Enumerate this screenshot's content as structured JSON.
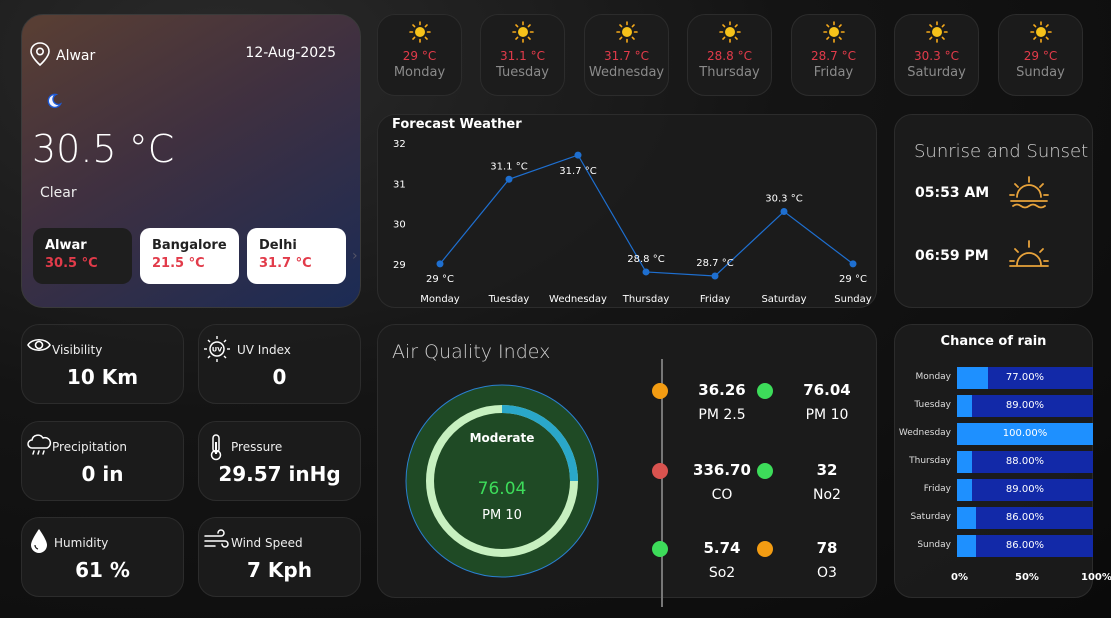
{
  "location": {
    "city": "Alwar",
    "date": "12-Aug-2025",
    "icon": "moon-icon",
    "temperature": "30.5 °C",
    "condition": "Clear"
  },
  "cities": [
    {
      "name": "Alwar",
      "temp": "30.5 °C"
    },
    {
      "name": "Bangalore",
      "temp": "21.5 °C"
    },
    {
      "name": "Delhi",
      "temp": "31.7 °C"
    }
  ],
  "week": [
    {
      "day": "Monday",
      "temp": "29 °C"
    },
    {
      "day": "Tuesday",
      "temp": "31.1 °C"
    },
    {
      "day": "Wednesday",
      "temp": "31.7 °C"
    },
    {
      "day": "Thursday",
      "temp": "28.8 °C"
    },
    {
      "day": "Friday",
      "temp": "28.7 °C"
    },
    {
      "day": "Saturday",
      "temp": "30.3 °C"
    },
    {
      "day": "Sunday",
      "temp": "29 °C"
    }
  ],
  "forecast": {
    "title": "Forecast Weather"
  },
  "chart_data": [
    {
      "type": "line",
      "title": "Forecast Weather",
      "categories": [
        "Monday",
        "Tuesday",
        "Wednesday",
        "Thursday",
        "Friday",
        "Saturday",
        "Sunday"
      ],
      "values": [
        29,
        31.1,
        31.7,
        28.8,
        28.7,
        30.3,
        29
      ],
      "labels": [
        "29 °C",
        "31.1 °C",
        "31.7 °C",
        "28.8 °C",
        "28.7 °C",
        "30.3 °C",
        "29 °C"
      ],
      "yticks": [
        29,
        30,
        31,
        32
      ],
      "ylim": [
        28.6,
        32
      ],
      "color": "#1e6fd0"
    },
    {
      "type": "bar",
      "title": "Chance of rain",
      "categories": [
        "Monday",
        "Tuesday",
        "Wednesday",
        "Thursday",
        "Friday",
        "Saturday",
        "Sunday"
      ],
      "values": [
        77,
        89,
        100,
        88,
        89,
        86,
        86
      ],
      "labels": [
        "77.00%",
        "89.00%",
        "100.00%",
        "88.00%",
        "89.00%",
        "86.00%",
        "86.00%"
      ],
      "xticks": [
        "0%",
        "50%",
        "100%"
      ],
      "color_fill": "#1e90ff",
      "color_track": "#1229a8"
    }
  ],
  "sun": {
    "title": "Sunrise and Sunset",
    "sunrise": "05:53 AM",
    "sunset": "06:59 PM"
  },
  "stats": {
    "visibility": {
      "label": "Visibility",
      "value": "10 Km"
    },
    "uv": {
      "label": "UV Index",
      "value": "0"
    },
    "precipitation": {
      "label": "Precipitation",
      "value": "0 in"
    },
    "pressure": {
      "label": "Pressure",
      "value": "29.57 inHg"
    },
    "humidity": {
      "label": "Humidity",
      "value": "61 %"
    },
    "wind": {
      "label": "Wind Speed",
      "value": "7 Kph"
    }
  },
  "aqi": {
    "title": "Air Quality Index",
    "status": "Moderate",
    "value": "76.04",
    "pollutant": "PM 10",
    "level": 0.25,
    "items": [
      {
        "value": "36.26",
        "name": "PM 2.5",
        "color": "#f39c12"
      },
      {
        "value": "76.04",
        "name": "PM 10",
        "color": "#3ddc5a"
      },
      {
        "value": "336.70",
        "name": "CO",
        "color": "#d9534f"
      },
      {
        "value": "32",
        "name": "No2",
        "color": "#3ddc5a"
      },
      {
        "value": "5.74",
        "name": "So2",
        "color": "#3ddc5a"
      },
      {
        "value": "78",
        "name": "O3",
        "color": "#f39c12"
      }
    ]
  },
  "rain": {
    "title": "Chance of rain"
  }
}
